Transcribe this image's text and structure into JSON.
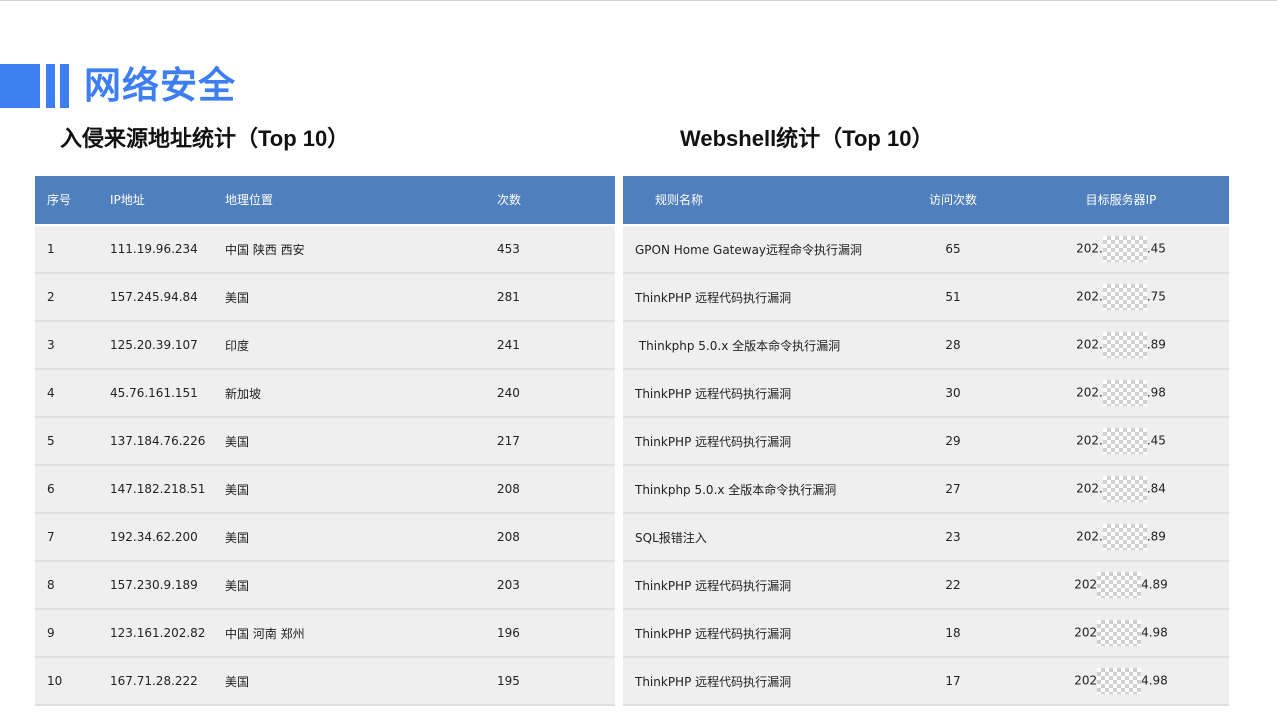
{
  "page": {
    "title": "网络安全",
    "left_subtitle": "入侵来源地址统计（Top 10）",
    "right_subtitle": "Webshell统计（Top 10）"
  },
  "colors": {
    "accent": "#3d7ff0",
    "header": "#4f7fbd",
    "row": "#efefef"
  },
  "intrusion_table": {
    "headers": [
      "序号",
      "IP地址",
      "地理位置",
      "次数"
    ],
    "rows": [
      [
        "1",
        "111.19.96.234",
        "中国 陕西 西安",
        "453"
      ],
      [
        "2",
        "157.245.94.84",
        "美国",
        "281"
      ],
      [
        "3",
        "125.20.39.107",
        "印度",
        "241"
      ],
      [
        "4",
        "45.76.161.151",
        "新加坡",
        "240"
      ],
      [
        "5",
        "137.184.76.226",
        "美国",
        "217"
      ],
      [
        "6",
        "147.182.218.51",
        "美国",
        "208"
      ],
      [
        "7",
        "192.34.62.200",
        "美国",
        "208"
      ],
      [
        "8",
        "157.230.9.189",
        "美国",
        "203"
      ],
      [
        "9",
        "123.161.202.82",
        "中国 河南 郑州",
        "196"
      ],
      [
        "10",
        "167.71.28.222",
        "美国",
        "195"
      ]
    ]
  },
  "webshell_table": {
    "headers": [
      "规则名称",
      "访问次数",
      "目标服务器IP"
    ],
    "rows": [
      {
        "rule": "GPON Home Gateway远程命令执行漏洞",
        "count": "65",
        "ip_prefix": "202.",
        "ip_suffix": ".45"
      },
      {
        "rule": "ThinkPHP 远程代码执行漏洞",
        "count": "51",
        "ip_prefix": "202.",
        "ip_suffix": ".75"
      },
      {
        "rule": " Thinkphp 5.0.x 全版本命令执行漏洞",
        "count": "28",
        "ip_prefix": "202.",
        "ip_suffix": ".89"
      },
      {
        "rule": "ThinkPHP 远程代码执行漏洞",
        "count": "30",
        "ip_prefix": "202.",
        "ip_suffix": ".98"
      },
      {
        "rule": "ThinkPHP 远程代码执行漏洞",
        "count": "29",
        "ip_prefix": "202.",
        "ip_suffix": ".45"
      },
      {
        "rule": "Thinkphp 5.0.x 全版本命令执行漏洞",
        "count": "27",
        "ip_prefix": "202.",
        "ip_suffix": ".84"
      },
      {
        "rule": "SQL报错注入",
        "count": "23",
        "ip_prefix": "202.",
        "ip_suffix": ".89"
      },
      {
        "rule": "ThinkPHP 远程代码执行漏洞",
        "count": "22",
        "ip_prefix": "202",
        "ip_suffix": "4.89"
      },
      {
        "rule": "ThinkPHP 远程代码执行漏洞",
        "count": "18",
        "ip_prefix": "202",
        "ip_suffix": "4.98"
      },
      {
        "rule": "ThinkPHP 远程代码执行漏洞",
        "count": "17",
        "ip_prefix": "202",
        "ip_suffix": "4.98"
      }
    ]
  }
}
